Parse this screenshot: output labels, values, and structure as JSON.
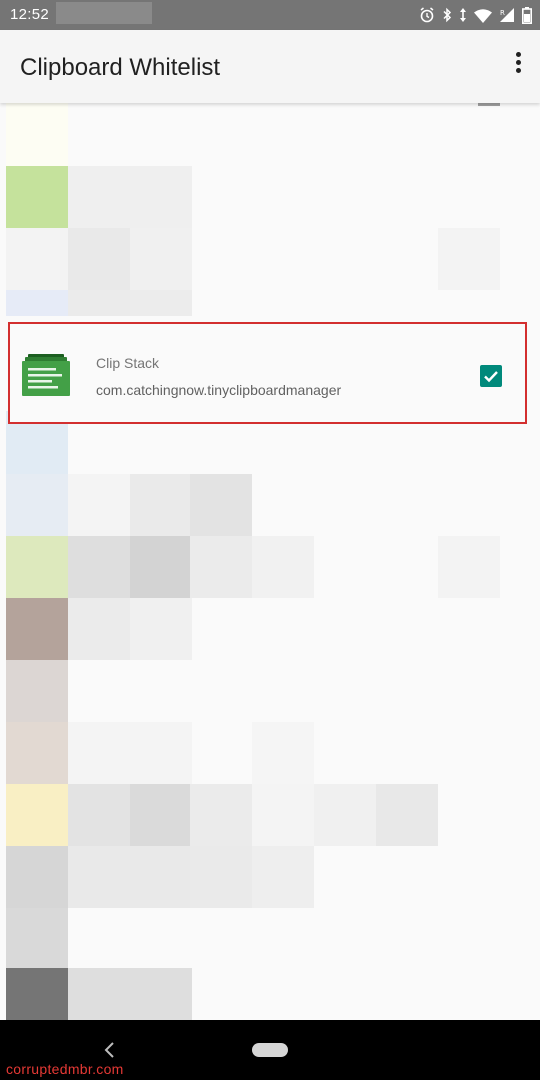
{
  "status_bar": {
    "time": "12:52",
    "icons": [
      "alarm-icon",
      "bluetooth-icon",
      "data-arrows-icon",
      "wifi-icon",
      "signal-roaming-icon",
      "battery-icon"
    ]
  },
  "app_bar": {
    "title": "Clipboard Whitelist",
    "overflow_icon": "more-vert-icon"
  },
  "list": {
    "highlighted_item": {
      "name": "Clip Stack",
      "package": "com.catchingnow.tinyclipboardmanager",
      "checked": true,
      "icon": "clip-stack-app-icon",
      "icon_color": "#43a047",
      "check_color": "#00897b",
      "highlight_color": "#d32f2f"
    }
  },
  "nav_bar": {
    "back_icon": "back-icon",
    "home_icon": "home-pill-icon"
  },
  "watermark": "corruptedmbr.com"
}
